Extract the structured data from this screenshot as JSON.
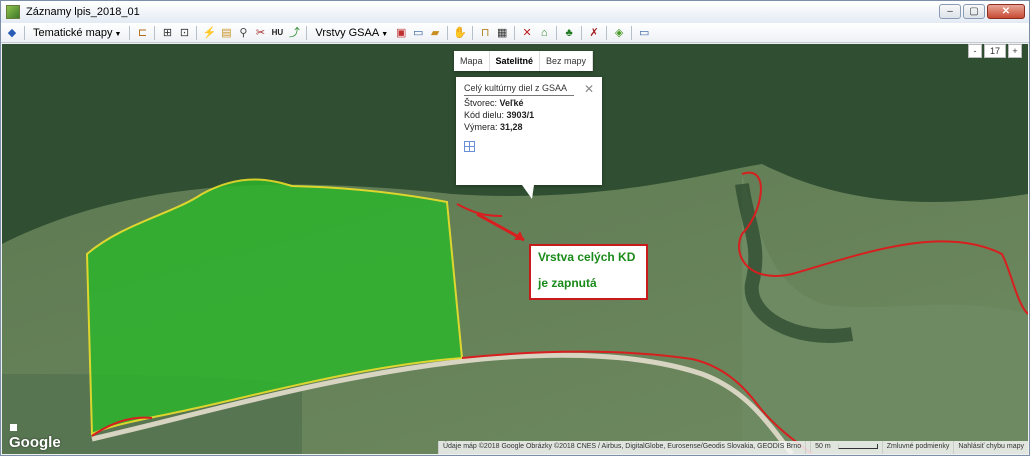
{
  "window": {
    "title": "Záznamy lpis_2018_01",
    "controls": [
      "–",
      "▢",
      "✕"
    ]
  },
  "toolbar": {
    "thematic_maps_label": "Tematické mapy",
    "hu_label": "HU",
    "gsaa_layers_label": "Vrstvy GSAA"
  },
  "map": {
    "type_buttons": [
      "Mapa",
      "Satelitné",
      "Bez mapy"
    ],
    "active_type": "Satelitné",
    "zoom": {
      "minus": "-",
      "level": "17",
      "plus": "+"
    },
    "popup": {
      "title": "Celý kultúrny diel z GSAA",
      "close": "✕",
      "rows": [
        {
          "label": "Štvorec:",
          "value": "Veľké"
        },
        {
          "label": "Kód dielu:",
          "value": "3903/1"
        },
        {
          "label": "Výmera:",
          "value": "31,28"
        }
      ]
    },
    "annotation": {
      "line1": "Vrstva celých KD",
      "line2": "je zapnutá",
      "color": "#1a8a1a",
      "border_color": "#c81a1a"
    },
    "google_logo": "Google",
    "attribution": {
      "data": "Údaje máp ©2018 Google Obrázky ©2018 CNES / Airbus, DigitalGlobe, Eurosense/Geodis Slovakia, GEODIS Brno",
      "scale": "50 m",
      "terms": "Zmluvné podmienky",
      "report": "Nahlásiť chybu mapy"
    },
    "colors": {
      "parcel_fill": "#2db52d",
      "parcel_border": "#f2e628",
      "gsaa_border": "#d81f1f"
    }
  }
}
